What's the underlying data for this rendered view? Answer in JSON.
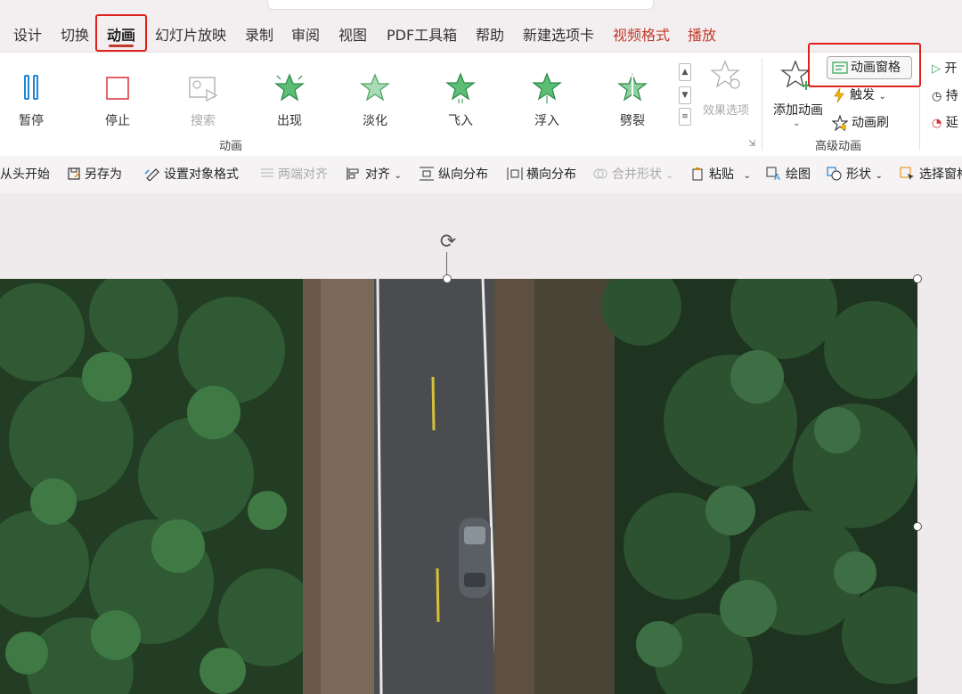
{
  "tabs": [
    {
      "label": "设计"
    },
    {
      "label": "切换"
    },
    {
      "label": "动画"
    },
    {
      "label": "幻灯片放映"
    },
    {
      "label": "录制"
    },
    {
      "label": "审阅"
    },
    {
      "label": "视图"
    },
    {
      "label": "PDF工具箱"
    },
    {
      "label": "帮助"
    },
    {
      "label": "新建选项卡"
    },
    {
      "label": "视频格式"
    },
    {
      "label": "播放"
    }
  ],
  "active_tab": "动画",
  "ribbon": {
    "animations": [
      {
        "label": "暂停",
        "icon": "pause-icon",
        "enabled": true
      },
      {
        "label": "停止",
        "icon": "stop-icon",
        "enabled": true
      },
      {
        "label": "搜索",
        "icon": "seek-icon",
        "enabled": false
      },
      {
        "label": "出现",
        "icon": "star-appear-icon",
        "enabled": true
      },
      {
        "label": "淡化",
        "icon": "star-fade-icon",
        "enabled": true
      },
      {
        "label": "飞入",
        "icon": "star-fly-in-icon",
        "enabled": true
      },
      {
        "label": "浮入",
        "icon": "star-float-in-icon",
        "enabled": true
      },
      {
        "label": "劈裂",
        "icon": "star-split-icon",
        "enabled": true
      }
    ],
    "effect_options_label": "效果选项",
    "animation_group_label": "动画",
    "add_animation_label": "添加动画",
    "animation_pane_label": "动画窗格",
    "trigger_label": "触发",
    "animation_painter_label": "动画刷",
    "advanced_group_label": "高级动画",
    "timing": {
      "start": "开",
      "duration": "持",
      "delay": "延"
    }
  },
  "quick_toolbar": [
    {
      "label": "从头开始",
      "icon": "",
      "enabled": true
    },
    {
      "label": "另存为",
      "icon": "save-as-icon",
      "enabled": true
    },
    {
      "label": "设置对象格式",
      "icon": "format-object-icon",
      "enabled": true
    },
    {
      "label": "两端对齐",
      "icon": "justify-icon",
      "enabled": false
    },
    {
      "label": "对齐",
      "icon": "align-icon",
      "enabled": true
    },
    {
      "label": "纵向分布",
      "icon": "distribute-vertical-icon",
      "enabled": true
    },
    {
      "label": "横向分布",
      "icon": "distribute-horizontal-icon",
      "enabled": true
    },
    {
      "label": "合并形状",
      "icon": "merge-shapes-icon",
      "enabled": false
    },
    {
      "label": "粘贴",
      "icon": "paste-icon",
      "enabled": true
    },
    {
      "label": "绘图",
      "icon": "draw-icon",
      "enabled": true
    },
    {
      "label": "形状",
      "icon": "shapes-icon",
      "enabled": true
    },
    {
      "label": "选择窗格",
      "icon": "selection-pane-icon",
      "enabled": true
    }
  ],
  "colors": {
    "highlight": "#e0201a",
    "red_tab": "#c0392b",
    "star_green": "#3aa85a",
    "pause_blue": "#1f86d6",
    "stop_red": "#d8313b"
  }
}
